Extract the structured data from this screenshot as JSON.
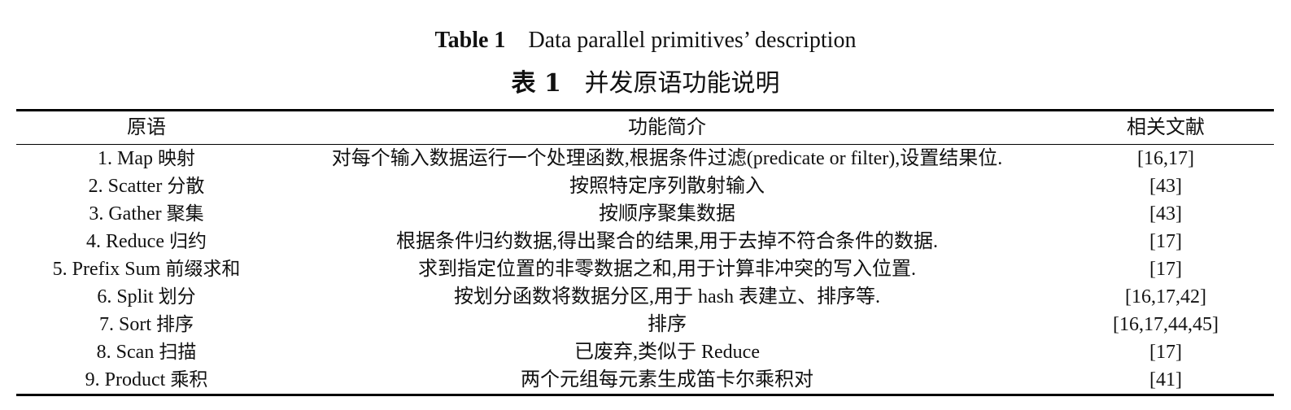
{
  "caption": {
    "en_label": "Table 1",
    "en_title": "Data parallel primitives’ description",
    "zh_label": "表 1",
    "zh_title": "并发原语功能说明"
  },
  "table": {
    "headers": [
      "原语",
      "功能简介",
      "相关文献"
    ],
    "rows": [
      {
        "primitive_en": "1. Map",
        "primitive_zh": "映射",
        "description": "对每个输入数据运行一个处理函数,根据条件过滤(predicate or filter),设置结果位.",
        "refs": "[16,17]"
      },
      {
        "primitive_en": "2. Scatter",
        "primitive_zh": "分散",
        "description": "按照特定序列散射输入",
        "refs": "[43]"
      },
      {
        "primitive_en": "3. Gather",
        "primitive_zh": "聚集",
        "description": "按顺序聚集数据",
        "refs": "[43]"
      },
      {
        "primitive_en": "4. Reduce",
        "primitive_zh": "归约",
        "description": "根据条件归约数据,得出聚合的结果,用于去掉不符合条件的数据.",
        "refs": "[17]"
      },
      {
        "primitive_en": "5. Prefix Sum",
        "primitive_zh": "前缀求和",
        "description": "求到指定位置的非零数据之和,用于计算非冲突的写入位置.",
        "refs": "[17]"
      },
      {
        "primitive_en": "6. Split",
        "primitive_zh": "划分",
        "description": "按划分函数将数据分区,用于 hash 表建立、排序等.",
        "refs": "[16,17,42]"
      },
      {
        "primitive_en": "7. Sort",
        "primitive_zh": "排序",
        "description": "排序",
        "refs": "[16,17,44,45]"
      },
      {
        "primitive_en": "8. Scan",
        "primitive_zh": "扫描",
        "description": "已废弃,类似于 Reduce",
        "refs": "[17]"
      },
      {
        "primitive_en": "9. Product",
        "primitive_zh": "乘积",
        "description": "两个元组每元素生成笛卡尔乘积对",
        "refs": "[41]"
      }
    ]
  }
}
